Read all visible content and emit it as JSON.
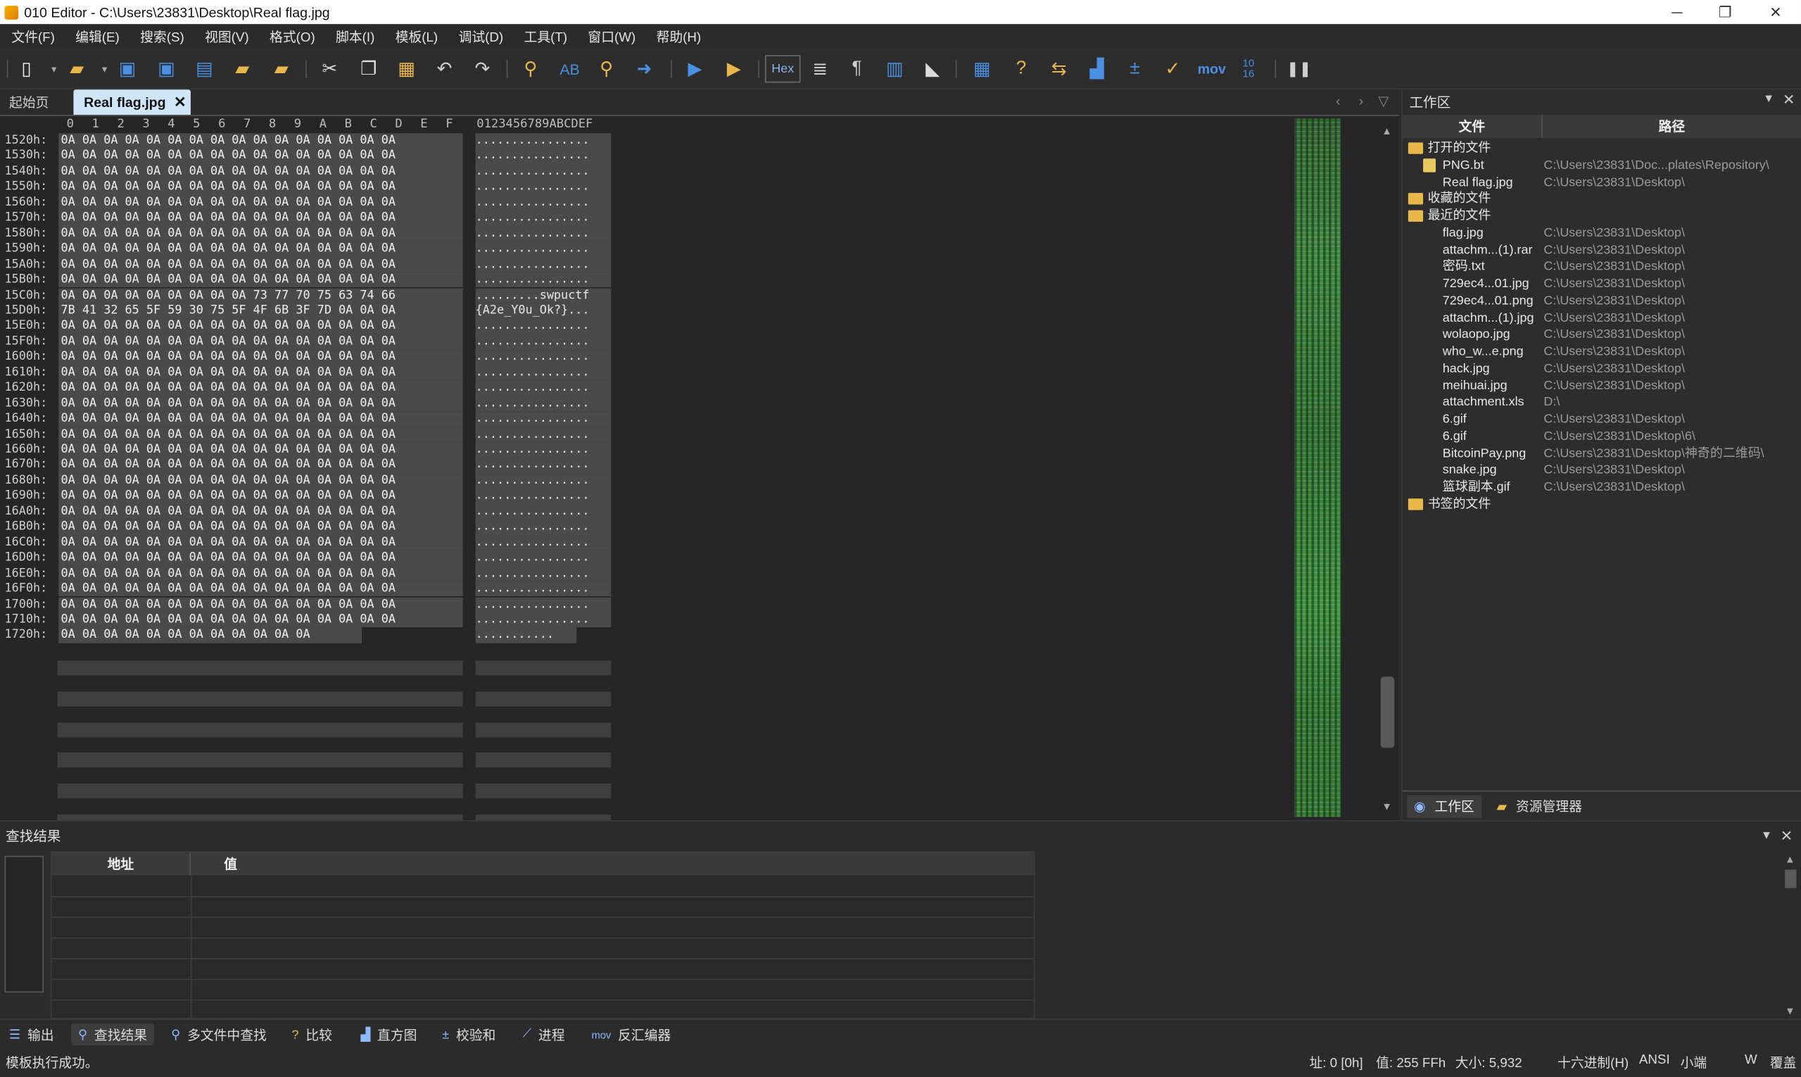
{
  "window": {
    "title": "010 Editor - C:\\Users\\23831\\Desktop\\Real flag.jpg",
    "minimize": "─",
    "restore": "❐",
    "close": "✕"
  },
  "menu": [
    "文件(F)",
    "编辑(E)",
    "搜索(S)",
    "视图(V)",
    "格式(O)",
    "脚本(I)",
    "模板(L)",
    "调试(D)",
    "工具(T)",
    "窗口(W)",
    "帮助(H)"
  ],
  "toolbar": {
    "hex_label": "Hex",
    "mov_label": "mov",
    "base_label": "10\n16"
  },
  "tabs": {
    "start": "起始页",
    "active": "Real flag.jpg",
    "close": "✕"
  },
  "editor": {
    "columns": [
      "0",
      "1",
      "2",
      "3",
      "4",
      "5",
      "6",
      "7",
      "8",
      "9",
      "A",
      "B",
      "C",
      "D",
      "E",
      "F"
    ],
    "ascii_header": "0123456789ABCDEF",
    "rows": [
      {
        "addr": "1520h:",
        "hex": "0A 0A 0A 0A 0A 0A 0A 0A 0A 0A 0A 0A 0A 0A 0A 0A",
        "ascii": "................"
      },
      {
        "addr": "1530h:",
        "hex": "0A 0A 0A 0A 0A 0A 0A 0A 0A 0A 0A 0A 0A 0A 0A 0A",
        "ascii": "................"
      },
      {
        "addr": "1540h:",
        "hex": "0A 0A 0A 0A 0A 0A 0A 0A 0A 0A 0A 0A 0A 0A 0A 0A",
        "ascii": "................"
      },
      {
        "addr": "1550h:",
        "hex": "0A 0A 0A 0A 0A 0A 0A 0A 0A 0A 0A 0A 0A 0A 0A 0A",
        "ascii": "................"
      },
      {
        "addr": "1560h:",
        "hex": "0A 0A 0A 0A 0A 0A 0A 0A 0A 0A 0A 0A 0A 0A 0A 0A",
        "ascii": "................"
      },
      {
        "addr": "1570h:",
        "hex": "0A 0A 0A 0A 0A 0A 0A 0A 0A 0A 0A 0A 0A 0A 0A 0A",
        "ascii": "................"
      },
      {
        "addr": "1580h:",
        "hex": "0A 0A 0A 0A 0A 0A 0A 0A 0A 0A 0A 0A 0A 0A 0A 0A",
        "ascii": "................"
      },
      {
        "addr": "1590h:",
        "hex": "0A 0A 0A 0A 0A 0A 0A 0A 0A 0A 0A 0A 0A 0A 0A 0A",
        "ascii": "................"
      },
      {
        "addr": "15A0h:",
        "hex": "0A 0A 0A 0A 0A 0A 0A 0A 0A 0A 0A 0A 0A 0A 0A 0A",
        "ascii": "................"
      },
      {
        "addr": "15B0h:",
        "hex": "0A 0A 0A 0A 0A 0A 0A 0A 0A 0A 0A 0A 0A 0A 0A 0A",
        "ascii": "................"
      },
      {
        "addr": "15C0h:",
        "hex": "0A 0A 0A 0A 0A 0A 0A 0A 0A 73 77 70 75 63 74 66",
        "ascii": ".........swpuctf"
      },
      {
        "addr": "15D0h:",
        "hex": "7B 41 32 65 5F 59 30 75 5F 4F 6B 3F 7D 0A 0A 0A",
        "ascii": "{A2e_Y0u_Ok?}..."
      },
      {
        "addr": "15E0h:",
        "hex": "0A 0A 0A 0A 0A 0A 0A 0A 0A 0A 0A 0A 0A 0A 0A 0A",
        "ascii": "................"
      },
      {
        "addr": "15F0h:",
        "hex": "0A 0A 0A 0A 0A 0A 0A 0A 0A 0A 0A 0A 0A 0A 0A 0A",
        "ascii": "................"
      },
      {
        "addr": "1600h:",
        "hex": "0A 0A 0A 0A 0A 0A 0A 0A 0A 0A 0A 0A 0A 0A 0A 0A",
        "ascii": "................"
      },
      {
        "addr": "1610h:",
        "hex": "0A 0A 0A 0A 0A 0A 0A 0A 0A 0A 0A 0A 0A 0A 0A 0A",
        "ascii": "................"
      },
      {
        "addr": "1620h:",
        "hex": "0A 0A 0A 0A 0A 0A 0A 0A 0A 0A 0A 0A 0A 0A 0A 0A",
        "ascii": "................"
      },
      {
        "addr": "1630h:",
        "hex": "0A 0A 0A 0A 0A 0A 0A 0A 0A 0A 0A 0A 0A 0A 0A 0A",
        "ascii": "................"
      },
      {
        "addr": "1640h:",
        "hex": "0A 0A 0A 0A 0A 0A 0A 0A 0A 0A 0A 0A 0A 0A 0A 0A",
        "ascii": "................"
      },
      {
        "addr": "1650h:",
        "hex": "0A 0A 0A 0A 0A 0A 0A 0A 0A 0A 0A 0A 0A 0A 0A 0A",
        "ascii": "................"
      },
      {
        "addr": "1660h:",
        "hex": "0A 0A 0A 0A 0A 0A 0A 0A 0A 0A 0A 0A 0A 0A 0A 0A",
        "ascii": "................"
      },
      {
        "addr": "1670h:",
        "hex": "0A 0A 0A 0A 0A 0A 0A 0A 0A 0A 0A 0A 0A 0A 0A 0A",
        "ascii": "................"
      },
      {
        "addr": "1680h:",
        "hex": "0A 0A 0A 0A 0A 0A 0A 0A 0A 0A 0A 0A 0A 0A 0A 0A",
        "ascii": "................"
      },
      {
        "addr": "1690h:",
        "hex": "0A 0A 0A 0A 0A 0A 0A 0A 0A 0A 0A 0A 0A 0A 0A 0A",
        "ascii": "................"
      },
      {
        "addr": "16A0h:",
        "hex": "0A 0A 0A 0A 0A 0A 0A 0A 0A 0A 0A 0A 0A 0A 0A 0A",
        "ascii": "................"
      },
      {
        "addr": "16B0h:",
        "hex": "0A 0A 0A 0A 0A 0A 0A 0A 0A 0A 0A 0A 0A 0A 0A 0A",
        "ascii": "................"
      },
      {
        "addr": "16C0h:",
        "hex": "0A 0A 0A 0A 0A 0A 0A 0A 0A 0A 0A 0A 0A 0A 0A 0A",
        "ascii": "................"
      },
      {
        "addr": "16D0h:",
        "hex": "0A 0A 0A 0A 0A 0A 0A 0A 0A 0A 0A 0A 0A 0A 0A 0A",
        "ascii": "................"
      },
      {
        "addr": "16E0h:",
        "hex": "0A 0A 0A 0A 0A 0A 0A 0A 0A 0A 0A 0A 0A 0A 0A 0A",
        "ascii": "................"
      },
      {
        "addr": "16F0h:",
        "hex": "0A 0A 0A 0A 0A 0A 0A 0A 0A 0A 0A 0A 0A 0A 0A 0A",
        "ascii": "................"
      },
      {
        "addr": "1700h:",
        "hex": "0A 0A 0A 0A 0A 0A 0A 0A 0A 0A 0A 0A 0A 0A 0A 0A",
        "ascii": "................"
      },
      {
        "addr": "1710h:",
        "hex": "0A 0A 0A 0A 0A 0A 0A 0A 0A 0A 0A 0A 0A 0A 0A 0A",
        "ascii": "................"
      },
      {
        "addr": "1720h:",
        "hex": "0A 0A 0A 0A 0A 0A 0A 0A 0A 0A 0A 0A",
        "ascii": "..........."
      }
    ]
  },
  "workspace": {
    "title": "工作区",
    "col_file": "文件",
    "col_path": "路径",
    "open_files_label": "打开的文件",
    "open_files": [
      {
        "name": "PNG.bt",
        "path": "C:\\Users\\23831\\Doc...plates\\Repository\\"
      },
      {
        "name": "Real flag.jpg",
        "path": "C:\\Users\\23831\\Desktop\\"
      }
    ],
    "favorites_label": "收藏的文件",
    "recent_label": "最近的文件",
    "recent_files": [
      {
        "name": "flag.jpg",
        "path": "C:\\Users\\23831\\Desktop\\"
      },
      {
        "name": "attachm...(1).rar",
        "path": "C:\\Users\\23831\\Desktop\\"
      },
      {
        "name": "密码.txt",
        "path": "C:\\Users\\23831\\Desktop\\"
      },
      {
        "name": "729ec4...01.jpg",
        "path": "C:\\Users\\23831\\Desktop\\"
      },
      {
        "name": "729ec4...01.png",
        "path": "C:\\Users\\23831\\Desktop\\"
      },
      {
        "name": "attachm...(1).jpg",
        "path": "C:\\Users\\23831\\Desktop\\"
      },
      {
        "name": "wolaopo.jpg",
        "path": "C:\\Users\\23831\\Desktop\\"
      },
      {
        "name": "who_w...e.png",
        "path": "C:\\Users\\23831\\Desktop\\"
      },
      {
        "name": "hack.jpg",
        "path": "C:\\Users\\23831\\Desktop\\"
      },
      {
        "name": "meihuai.jpg",
        "path": "C:\\Users\\23831\\Desktop\\"
      },
      {
        "name": "attachment.xls",
        "path": "D:\\"
      },
      {
        "name": "6.gif",
        "path": "C:\\Users\\23831\\Desktop\\"
      },
      {
        "name": "6.gif",
        "path": "C:\\Users\\23831\\Desktop\\6\\"
      },
      {
        "name": "BitcoinPay.png",
        "path": "C:\\Users\\23831\\Desktop\\神奇的二维码\\"
      },
      {
        "name": "snake.jpg",
        "path": "C:\\Users\\23831\\Desktop\\"
      },
      {
        "name": "篮球副本.gif",
        "path": "C:\\Users\\23831\\Desktop\\"
      }
    ],
    "bookmarks_label": "书签的文件",
    "tab_workspace": "工作区",
    "tab_explorer": "资源管理器"
  },
  "find": {
    "title": "查找结果",
    "col_address": "地址",
    "col_value": "值"
  },
  "bottom_tabs": [
    "输出",
    "查找结果",
    "多文件中查找",
    "比较",
    "直方图",
    "校验和",
    "进程",
    "反汇编器"
  ],
  "status": {
    "message": "模板执行成功。",
    "address": "址: 0 [0h]",
    "value": "值: 255 FFh",
    "size": "大小: 5,932",
    "mode": "十六进制(H)",
    "encoding": "ANSI",
    "endian": "小端",
    "w": "W",
    "overwrite": "覆盖"
  }
}
